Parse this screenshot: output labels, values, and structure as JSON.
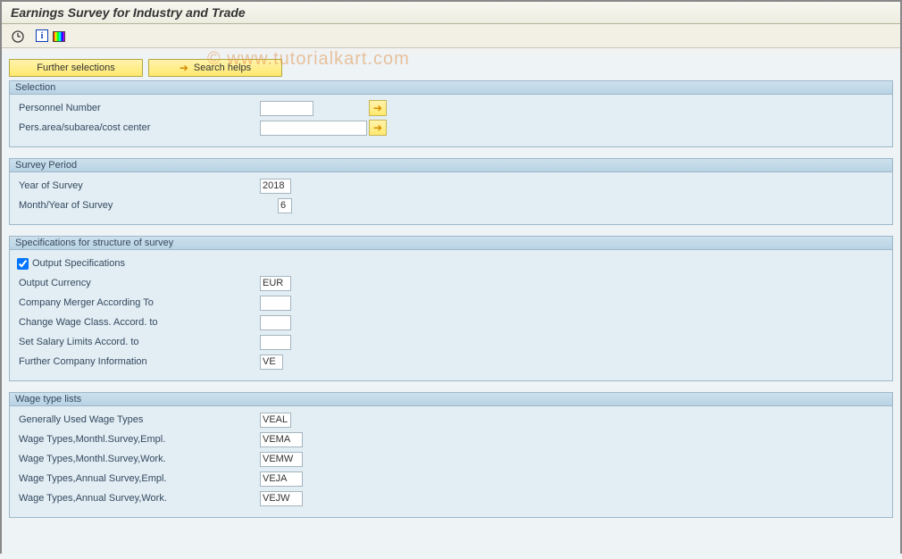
{
  "title": "Earnings Survey for Industry and Trade",
  "watermark": "© www.tutorialkart.com",
  "toolbar_icons": {
    "execute": "execute",
    "info": "i",
    "colors": "colors"
  },
  "buttons": {
    "further_selections": "Further selections",
    "search_helps": "Search helps"
  },
  "groups": {
    "selection": {
      "title": "Selection",
      "personnel_number_label": "Personnel Number",
      "personnel_number_value": "",
      "pers_area_label": "Pers.area/subarea/cost center",
      "pers_area_value": ""
    },
    "survey_period": {
      "title": "Survey Period",
      "year_label": "Year of Survey",
      "year_value": "2018",
      "month_label": "Month/Year of Survey",
      "month_value": "6"
    },
    "specs": {
      "title": "Specifications for structure of survey",
      "output_spec_label": "Output Specifications",
      "output_spec_checked": true,
      "output_currency_label": "Output Currency",
      "output_currency_value": "EUR",
      "merger_label": "Company Merger According To",
      "merger_value": "",
      "change_wage_label": "Change Wage Class. Accord. to",
      "change_wage_value": "",
      "salary_limits_label": "Set Salary Limits Accord. to",
      "salary_limits_value": "",
      "further_company_label": "Further Company Information",
      "further_company_value": "VE"
    },
    "wage_type_lists": {
      "title": "Wage type lists",
      "general_label": "Generally Used Wage Types",
      "general_value": "VEAL",
      "monthly_empl_label": "Wage Types,Monthl.Survey,Empl.",
      "monthly_empl_value": "VEMA",
      "monthly_work_label": "Wage Types,Monthl.Survey,Work.",
      "monthly_work_value": "VEMW",
      "annual_empl_label": "Wage Types,Annual Survey,Empl.",
      "annual_empl_value": "VEJA",
      "annual_work_label": "Wage Types,Annual Survey,Work.",
      "annual_work_value": "VEJW"
    }
  }
}
